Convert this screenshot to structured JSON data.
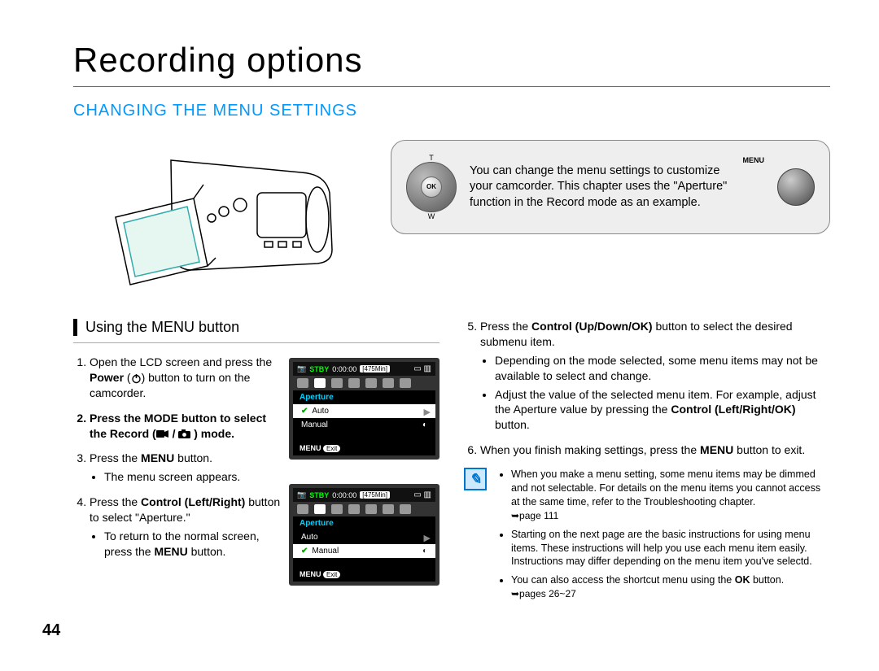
{
  "chapter_title": "Recording options",
  "section_title": "CHANGING THE MENU SETTINGS",
  "info_box": {
    "dial_ok": "OK",
    "dial_t": "T",
    "dial_w": "W",
    "menu_label": "MENU",
    "text": "You can change the menu settings to customize your camcorder. This chapter uses the \"Aperture\" function in the Record mode as an example."
  },
  "subsection_title": "Using the MENU button",
  "steps_left": {
    "s1_a": "Open the LCD screen and press the ",
    "s1_b": "Power",
    "s1_c": " (",
    "s1_d": ") button to turn on the camcorder.",
    "s2_a": "Press the MODE button to select the Record (",
    "s2_b": " / ",
    "s2_c": " ) mode.",
    "s3_a": "Press the ",
    "s3_b": "MENU",
    "s3_c": " button.",
    "s3_sub": "The menu screen appears.",
    "s4_a": "Press the ",
    "s4_b": "Control (Left/Right)",
    "s4_c": " button to select \"Aperture.\"",
    "s4_sub_a": "To return to the normal screen, press the ",
    "s4_sub_b": "MENU",
    "s4_sub_c": " button."
  },
  "lcd": {
    "stby": "STBY",
    "time": "0:00:00",
    "remaining": "[475Min]",
    "aperture": "Aperture",
    "auto": "Auto",
    "manual": "Manual",
    "menu": "MENU",
    "exit": "Exit"
  },
  "steps_right": {
    "s5_a": "Press the ",
    "s5_b": "Control (Up/Down/OK)",
    "s5_c": " button to select the desired submenu item.",
    "s5_sub1": "Depending on the mode selected, some menu items may not be available to select and change.",
    "s5_sub2_a": "Adjust the value of the selected menu item. For example, adjust the Aperture value by pressing the ",
    "s5_sub2_b": "Control (Left/Right/OK)",
    "s5_sub2_c": " button.",
    "s6_a": "When you finish making settings, press the ",
    "s6_b": "MENU",
    "s6_c": " button to exit."
  },
  "notes": {
    "n1": "When you make a menu setting, some menu items may be dimmed and not selectable. For details on the menu items you cannot access at the same time, refer to the Troubleshooting chapter.",
    "n1_ref": "➥page 111",
    "n2": "Starting on the next page are the basic instructions for using menu items. These instructions will help you use each menu item easily. Instructions may differ depending on the menu item you've selectd.",
    "n3_a": "You can also access the shortcut menu using the ",
    "n3_b": "OK",
    "n3_c": " button.",
    "n3_ref": "➥pages 26~27"
  },
  "page_number": "44"
}
